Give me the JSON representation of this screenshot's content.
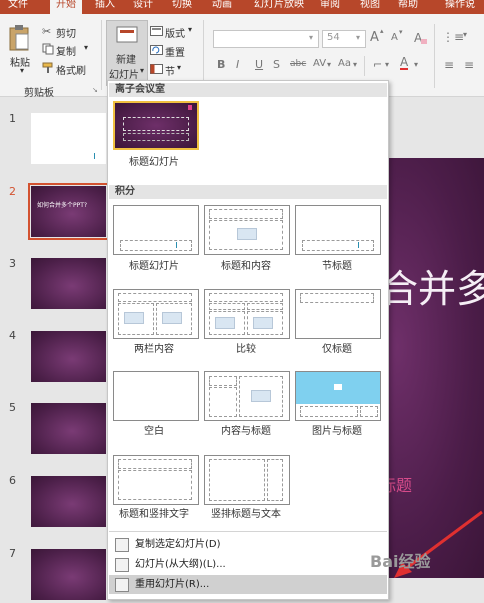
{
  "tabs": [
    {
      "label": "文件",
      "active": false
    },
    {
      "label": "开始",
      "active": true
    },
    {
      "label": "插入",
      "active": false
    },
    {
      "label": "设计",
      "active": false
    },
    {
      "label": "切换",
      "active": false
    },
    {
      "label": "动画",
      "active": false
    },
    {
      "label": "幻灯片放映",
      "active": false
    },
    {
      "label": "审阅",
      "active": false
    },
    {
      "label": "视图",
      "active": false
    },
    {
      "label": "帮助",
      "active": false
    },
    {
      "label": "操作说",
      "active": false
    }
  ],
  "clipboard": {
    "paste": "粘贴",
    "cut": "剪切",
    "copy": "复制",
    "format_painter": "格式刷",
    "group": "剪贴板"
  },
  "slides_group": {
    "new_slide_line1": "新建",
    "new_slide_line2": "幻灯片",
    "layout": "版式",
    "reset": "重置",
    "section": "节"
  },
  "font": {
    "family": "",
    "size": "54",
    "bold": "B",
    "italic": "I",
    "underline": "U",
    "strike": "S",
    "abc": "abc",
    "spacing": "AV",
    "case": "Aa",
    "grow": "A",
    "shrink": "A",
    "color": "A"
  },
  "slide_numbers": [
    "1",
    "2",
    "3",
    "4",
    "5",
    "6",
    "7"
  ],
  "thumb2_title": "如何合并多个PPT?",
  "main_slide": {
    "title": "合并多",
    "subtitle": "标题"
  },
  "dropdown": {
    "section1": "离子会议室",
    "section1_layouts": [
      {
        "name": "标题幻灯片"
      }
    ],
    "section2": "积分",
    "section2_layouts": [
      {
        "name": "标题幻灯片"
      },
      {
        "name": "标题和内容"
      },
      {
        "name": "节标题"
      },
      {
        "name": "两栏内容"
      },
      {
        "name": "比较"
      },
      {
        "name": "仅标题"
      },
      {
        "name": "空白"
      },
      {
        "name": "内容与标题"
      },
      {
        "name": "图片与标题"
      },
      {
        "name": "标题和竖排文字"
      },
      {
        "name": "竖排标题与文本"
      }
    ],
    "menu": [
      {
        "label": "复制选定幻灯片(D)"
      },
      {
        "label": "幻灯片(从大纲)(L)..."
      },
      {
        "label": "重用幻灯片(R)..."
      }
    ]
  },
  "watermark": "Bai经验",
  "colors": {
    "accent": "#b7472a",
    "slide_bg": "#4c1d49",
    "pattern": "#2a8fb0",
    "highlight": "#f0c040"
  }
}
